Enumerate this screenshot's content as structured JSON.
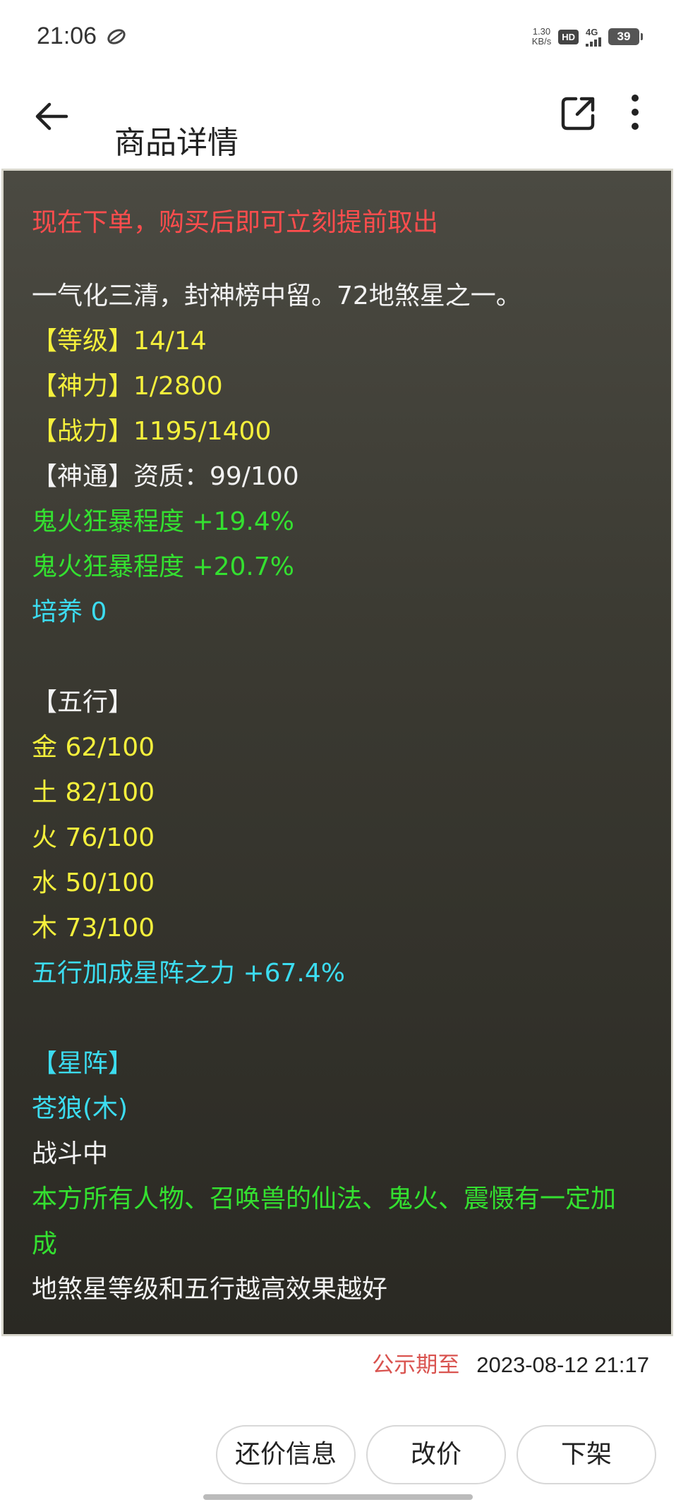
{
  "status_bar": {
    "time": "21:06",
    "net_speed_value": "1.30",
    "net_speed_unit": "KB/s",
    "hd": "HD",
    "network": "4G",
    "battery": "39"
  },
  "header": {
    "title": "商品详情",
    "back_icon": "arrow-left-icon",
    "share_icon": "share-external-icon",
    "more_icon": "more-vertical-icon"
  },
  "detail": {
    "lines": [
      {
        "text": "现在下单，购买后即可立刻提前取出",
        "color": "#ff4d4d"
      },
      {
        "text": "一气化三清，封神榜中留。72地煞星之一。",
        "color": "#f2f2f2"
      },
      {
        "text": "【等级】14/14",
        "color": "#f5f03c"
      },
      {
        "text": "【神力】1/2800",
        "color": "#f5f03c"
      },
      {
        "text": "【战力】1195/1400",
        "color": "#f5f03c"
      },
      {
        "text": "【神通】资质：99/100",
        "color": "#f2f2f2"
      },
      {
        "text": "鬼火狂暴程度 +19.4%",
        "color": "#34e030"
      },
      {
        "text": "鬼火狂暴程度 +20.7%",
        "color": "#34e030"
      },
      {
        "text": "培养 0",
        "color": "#3cdcf0"
      },
      {
        "text": "【五行】",
        "color": "#f2f2f2"
      },
      {
        "text": "金 62/100",
        "color": "#f5f03c"
      },
      {
        "text": "土 82/100",
        "color": "#f5f03c"
      },
      {
        "text": "火 76/100",
        "color": "#f5f03c"
      },
      {
        "text": "水 50/100",
        "color": "#f5f03c"
      },
      {
        "text": "木 73/100",
        "color": "#f5f03c"
      },
      {
        "text": "五行加成星阵之力 +67.4%",
        "color": "#3cdcf0"
      },
      {
        "text": "【星阵】",
        "color": "#3cdcf0"
      },
      {
        "text": "苍狼(木)",
        "color": "#3cdcf0"
      },
      {
        "text": "战斗中",
        "color": "#f2f2f2"
      },
      {
        "text": "本方所有人物、召唤兽的仙法、鬼火、震慑有一定加",
        "color": "#34e030"
      },
      {
        "text": "成",
        "color": "#34e030"
      },
      {
        "text": "地煞星等级和五行越高效果越好",
        "color": "#f2f2f2"
      }
    ]
  },
  "notice": {
    "label": "公示期至",
    "date": "2023-08-12 21:17"
  },
  "actions": {
    "counter_offer": "还价信息",
    "change_price": "改价",
    "delist": "下架"
  }
}
